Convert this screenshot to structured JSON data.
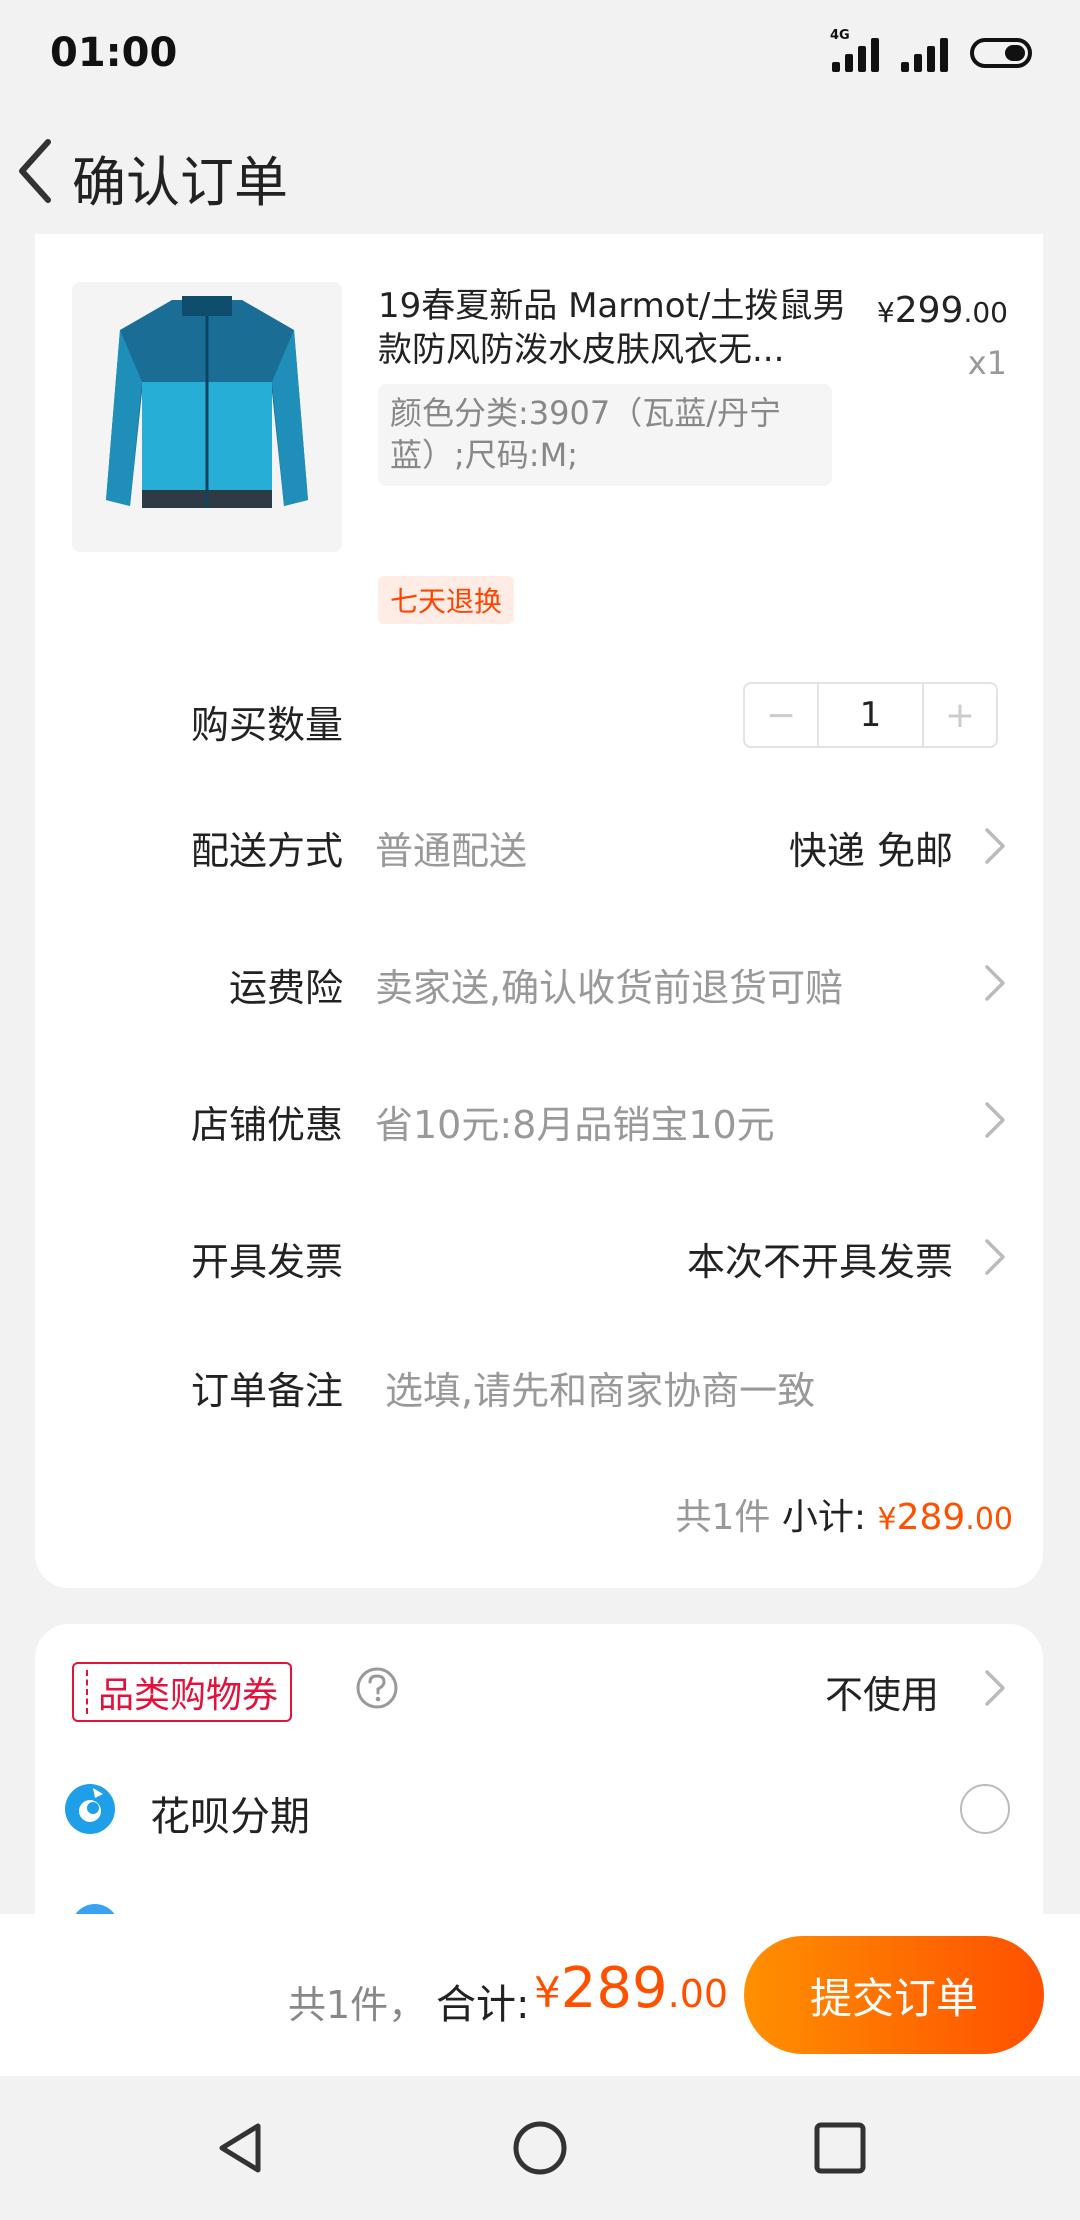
{
  "status_bar": {
    "time": "01:00",
    "network_tag": "4G",
    "icons": [
      "signal-4g-icon",
      "signal-icon",
      "battery-icon"
    ]
  },
  "header": {
    "title": "确认订单",
    "back_icon": "chevron-left-icon"
  },
  "item": {
    "title": "19春夏新品 Marmot/土拨鼠男款防风防泼水皮肤风衣无...",
    "currency": "¥",
    "price_int": "299",
    "price_dec": ".00",
    "quantity_label": "x1",
    "sku": "颜色分类:3907（瓦蓝/丹宁蓝）;尺码:M;",
    "return_tag": "七天退换"
  },
  "rows": {
    "quantity": {
      "label": "购买数量",
      "value": "1",
      "minus": "−",
      "plus": "+"
    },
    "shipping": {
      "label": "配送方式",
      "value": "普通配送",
      "right_value": "快递 免邮"
    },
    "insurance": {
      "label": "运费险",
      "value": "卖家送,确认收货前退货可赔"
    },
    "discount": {
      "label": "店铺优惠",
      "value": "省10元:8月品销宝10元"
    },
    "invoice": {
      "label": "开具发票",
      "right_value": "本次不开具发票"
    },
    "note": {
      "label": "订单备注",
      "placeholder": "选填,请先和商家协商一致"
    }
  },
  "subtotal": {
    "count": "共1件",
    "label": "小计:",
    "currency": "¥",
    "amount_int": "289",
    "amount_dec": ".00"
  },
  "payment": {
    "coupon_label": "品类购物券",
    "coupon_value": "不使用",
    "huabei_label": "花呗分期"
  },
  "action_bar": {
    "count": "共1件，",
    "total_label": "合计:",
    "currency": "¥",
    "amount_int": "289",
    "amount_dec": ".00",
    "submit_label": "提交订单"
  },
  "colors": {
    "accent": "#ff5000",
    "coupon_red": "#e3113c",
    "background": "#f2f2f2"
  }
}
